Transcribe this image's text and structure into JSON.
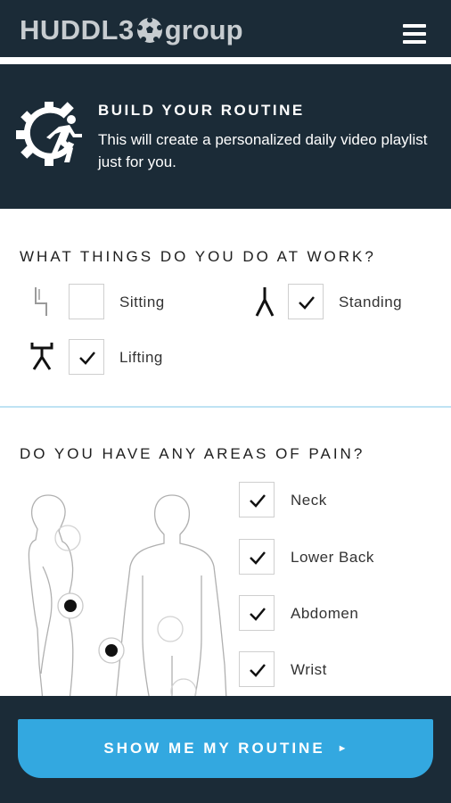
{
  "header": {
    "logo_left": "HUDDL3",
    "logo_right": "group"
  },
  "banner": {
    "title": "BUILD YOUR ROUTINE",
    "description": "This will create a personalized daily video playlist just for you."
  },
  "work": {
    "title": "WHAT THINGS DO YOU DO AT WORK?",
    "options": [
      {
        "label": "Sitting",
        "checked": false
      },
      {
        "label": "Standing",
        "checked": true
      },
      {
        "label": "Lifting",
        "checked": true
      }
    ]
  },
  "pain": {
    "title": "DO YOU HAVE ANY AREAS OF PAIN?",
    "options": [
      {
        "label": "Neck",
        "checked": true
      },
      {
        "label": "Lower Back",
        "checked": true
      },
      {
        "label": "Abdomen",
        "checked": true
      },
      {
        "label": "Wrist",
        "checked": true
      }
    ]
  },
  "cta": {
    "label": "SHOW ME MY ROUTINE",
    "arrow": "►"
  },
  "colors": {
    "navy": "#1b2b37",
    "accent": "#33a8e0"
  }
}
